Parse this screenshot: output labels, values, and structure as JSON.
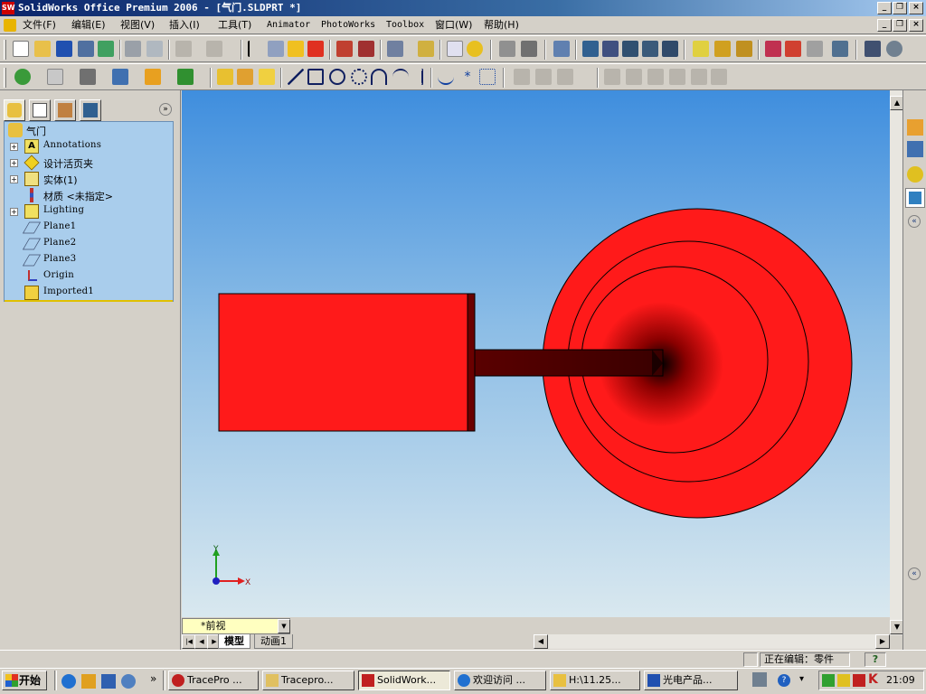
{
  "window": {
    "title": "SolidWorks Office Premium 2006 - [气门.SLDPRT *]",
    "app_icon_text": "SW"
  },
  "menu": {
    "items": [
      "文件(F)",
      "编辑(E)",
      "视图(V)",
      "插入(I)",
      "工具(T)",
      "Animator",
      "PhotoWorks",
      "Toolbox",
      "窗口(W)",
      "帮助(H)"
    ]
  },
  "feature_tree": {
    "root": "气门",
    "items": [
      {
        "label": "Annotations",
        "expandable": true,
        "icon": "annotations-icon"
      },
      {
        "label": "设计活页夹",
        "expandable": true,
        "icon": "design-binder-icon"
      },
      {
        "label": "实体(1)",
        "expandable": true,
        "icon": "solid-bodies-icon"
      },
      {
        "label": "材质 <未指定>",
        "expandable": false,
        "icon": "material-icon"
      },
      {
        "label": "Lighting",
        "expandable": true,
        "icon": "lighting-icon"
      },
      {
        "label": "Plane1",
        "expandable": false,
        "icon": "plane-icon"
      },
      {
        "label": "Plane2",
        "expandable": false,
        "icon": "plane-icon"
      },
      {
        "label": "Plane3",
        "expandable": false,
        "icon": "plane-icon"
      },
      {
        "label": "Origin",
        "expandable": false,
        "icon": "origin-icon"
      },
      {
        "label": "Imported1",
        "expandable": false,
        "icon": "imported-feature-icon"
      }
    ]
  },
  "view": {
    "current_view": "*前视",
    "triad": {
      "x_label": "X",
      "y_label": "Y"
    }
  },
  "sheet_tabs": [
    "模型",
    "动画1"
  ],
  "status": {
    "editing": "正在编辑：零件",
    "help_icon": "?"
  },
  "taskbar": {
    "start_label": "开始",
    "tasks": [
      {
        "label": "TracePro ...",
        "icon": "tracepro-icon",
        "active": false
      },
      {
        "label": "Tracepro...",
        "icon": "image-editor-icon",
        "active": false
      },
      {
        "label": "SolidWork...",
        "icon": "solidworks-icon",
        "active": true
      },
      {
        "label": "欢迎访问 ...",
        "icon": "browser-icon",
        "active": false
      },
      {
        "label": "H:\\11.25...",
        "icon": "folder-icon",
        "active": false
      },
      {
        "label": "光电产品...",
        "icon": "word-icon",
        "active": false
      }
    ],
    "clock": "21:09"
  },
  "colors": {
    "part_red": "#ff1a1a",
    "stem_dark": "#5a0000",
    "tree_bg": "#a9cdec",
    "title_bar": "#0a246a"
  }
}
